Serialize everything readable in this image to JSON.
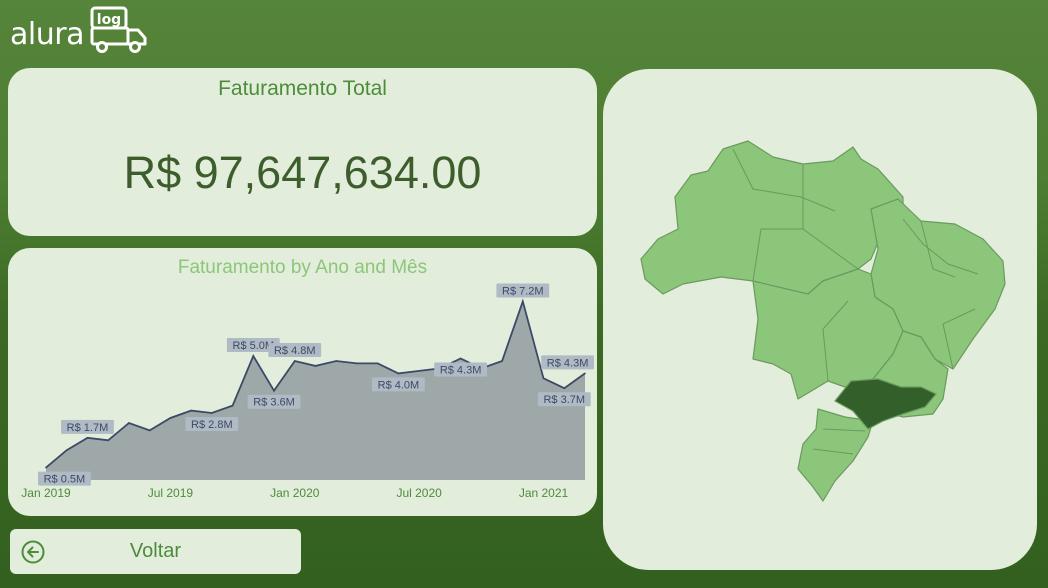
{
  "logo": {
    "text": "alura",
    "badge": "log"
  },
  "kpi": {
    "title": "Faturamento Total",
    "value": "R$ 97,647,634.00"
  },
  "chart_data": {
    "type": "area",
    "title": "Faturamento by Ano and Mês",
    "xlabel": "",
    "ylabel": "",
    "ylim": [
      0,
      7.5
    ],
    "x_ticks": [
      "Jan 2019",
      "Jul 2019",
      "Jan 2020",
      "Jul 2020",
      "Jan 2021"
    ],
    "x": [
      "2019-01",
      "2019-02",
      "2019-03",
      "2019-04",
      "2019-05",
      "2019-06",
      "2019-07",
      "2019-08",
      "2019-09",
      "2019-10",
      "2019-11",
      "2019-12",
      "2020-01",
      "2020-02",
      "2020-03",
      "2020-04",
      "2020-05",
      "2020-06",
      "2020-07",
      "2020-08",
      "2020-09",
      "2020-10",
      "2020-11",
      "2020-12",
      "2021-01",
      "2021-02",
      "2021-03"
    ],
    "series": [
      {
        "values": [
          0.5,
          1.2,
          1.7,
          1.6,
          2.3,
          2.0,
          2.5,
          2.8,
          2.7,
          3.0,
          5.0,
          3.6,
          4.8,
          4.6,
          4.8,
          4.7,
          4.7,
          4.3,
          4.4,
          4.5,
          4.9,
          4.5,
          4.8,
          7.2,
          4.1,
          3.7,
          4.3
        ]
      }
    ],
    "data_labels": [
      {
        "index": 0,
        "text": "R$ 0.5M",
        "pos": "below"
      },
      {
        "index": 2,
        "text": "R$ 1.7M",
        "pos": "above"
      },
      {
        "index": 8,
        "text": "R$ 2.8M",
        "pos": "below"
      },
      {
        "index": 10,
        "text": "R$ 5.0M",
        "pos": "above"
      },
      {
        "index": 11,
        "text": "R$ 3.6M",
        "pos": "below"
      },
      {
        "index": 12,
        "text": "R$ 4.8M",
        "pos": "above"
      },
      {
        "index": 17,
        "text": "R$ 4.0M",
        "pos": "below"
      },
      {
        "index": 20,
        "text": "R$ 4.3M",
        "pos": "below"
      },
      {
        "index": 23,
        "text": "R$ 7.2M",
        "pos": "above"
      },
      {
        "index": 25,
        "text": "R$ 3.7M",
        "pos": "below"
      },
      {
        "index": 26,
        "text": "R$ 4.3M",
        "pos": "above"
      }
    ],
    "colors": {
      "fill": "#9ea8a8",
      "line": "#3b4a66",
      "label_bg": "#b0bac4",
      "label_text": "#3b4a66"
    }
  },
  "map": {
    "highlight_region": "São Paulo",
    "base_color": "#8cc67a",
    "highlight_color": "#33602a",
    "border_color": "#6a9a5e"
  },
  "back_button": {
    "label": "Voltar"
  }
}
